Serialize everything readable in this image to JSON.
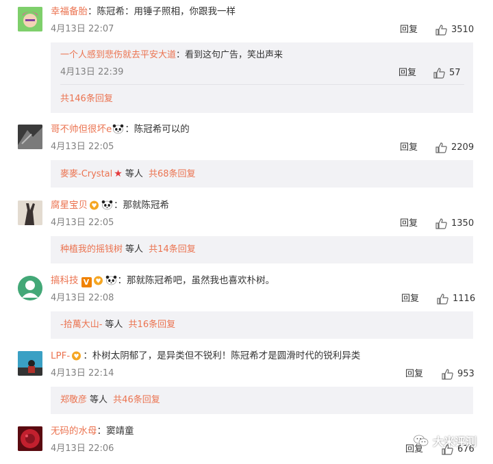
{
  "comments": [
    {
      "user": "幸福备胎",
      "text": "：陈冠希：用锤子照相，你跟我一样",
      "date": "4月13日 22:07",
      "reply_label": "回复",
      "likes": "3510",
      "sub_reply": {
        "user": "一个人感到悲伤就去平安大道",
        "text": "：看到这句广告，笑出声来",
        "date": "4月13日 22:39",
        "reply_label": "回复",
        "likes": "57"
      },
      "total_replies": "共146条回复"
    },
    {
      "user": "哥不帅但很坏e",
      "text": "：陈冠希可以的",
      "date": "4月13日 22:05",
      "reply_label": "回复",
      "likes": "2209",
      "replier": "麥麥-Crystal",
      "and_others": "等人",
      "total_replies": "共68条回复"
    },
    {
      "user": "腐星宝贝",
      "text": "：那就陈冠希",
      "date": "4月13日 22:05",
      "reply_label": "回复",
      "likes": "1350",
      "replier": "种植我的摇钱树",
      "and_others": "等人",
      "total_replies": "共14条回复"
    },
    {
      "user": "搞科技",
      "vbadge": "V",
      "text": "：那就陈冠希吧，虽然我也喜欢朴树。",
      "date": "4月13日 22:08",
      "reply_label": "回复",
      "likes": "1116",
      "replier": "-拾萬大山-",
      "and_others": "等人",
      "total_replies": "共16条回复"
    },
    {
      "user": "LPF-",
      "text": "：朴树太阴郁了，是异类但不锐利！陈冠希才是圆滑时代的锐利异类",
      "date": "4月13日 22:14",
      "reply_label": "回复",
      "likes": "953",
      "replier": "郑敬彦",
      "and_others": "等人",
      "total_replies": "共46条回复"
    },
    {
      "user": "无码的水母",
      "text": "：窦靖童",
      "date": "4月13日 22:06",
      "reply_label": "回复",
      "likes": "676"
    }
  ],
  "watermark": "大米评测",
  "icons": {
    "like": "thumbs-up-icon",
    "wechat": "wechat-icon",
    "panda": "panda-emoji-icon"
  },
  "colors": {
    "username": "#eb7350",
    "box_bg": "#f2f2f5",
    "date": "#808080"
  }
}
